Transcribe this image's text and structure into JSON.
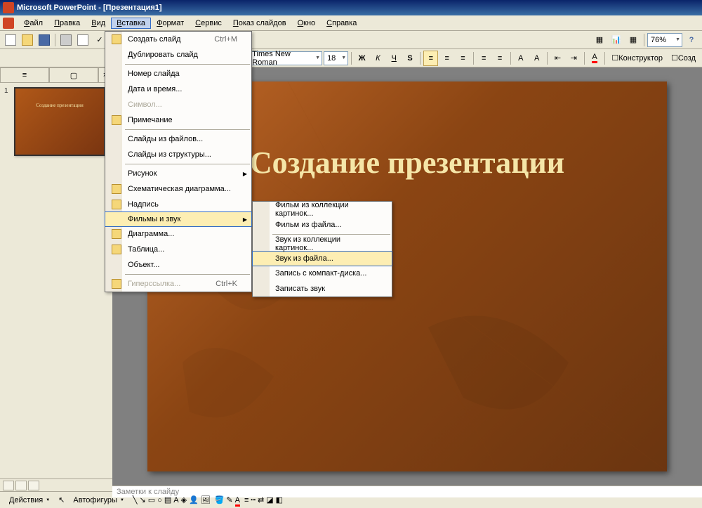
{
  "title": "Microsoft PowerPoint - [Презентация1]",
  "menubar": [
    "Файл",
    "Правка",
    "Вид",
    "Вставка",
    "Формат",
    "Сервис",
    "Показ слайдов",
    "Окно",
    "Справка"
  ],
  "active_menu_index": 3,
  "toolbar2": {
    "font": "Times New Roman",
    "size": "18",
    "zoom": "76%",
    "designer": "Конструктор",
    "create": "Созд"
  },
  "insert_menu": [
    {
      "label": "Создать слайд",
      "shortcut": "Ctrl+M",
      "icon": "new-slide"
    },
    {
      "label": "Дублировать слайд"
    },
    {
      "sep": true
    },
    {
      "label": "Номер слайда"
    },
    {
      "label": "Дата и время..."
    },
    {
      "label": "Символ...",
      "disabled": true
    },
    {
      "label": "Примечание",
      "icon": "note"
    },
    {
      "sep": true
    },
    {
      "label": "Слайды из файлов..."
    },
    {
      "label": "Слайды из структуры..."
    },
    {
      "sep": true
    },
    {
      "label": "Рисунок",
      "submenu": true
    },
    {
      "label": "Схематическая диаграмма...",
      "icon": "diagram"
    },
    {
      "label": "Надпись",
      "icon": "textbox"
    },
    {
      "label": "Фильмы и звук",
      "submenu": true,
      "highlighted": true
    },
    {
      "label": "Диаграмма...",
      "icon": "chart"
    },
    {
      "label": "Таблица...",
      "icon": "table"
    },
    {
      "label": "Объект..."
    },
    {
      "sep": true
    },
    {
      "label": "Гиперссылка...",
      "shortcut": "Ctrl+K",
      "disabled": true,
      "icon": "link"
    }
  ],
  "sound_submenu": [
    {
      "label": "Фильм из коллекции картинок..."
    },
    {
      "label": "Фильм из файла..."
    },
    {
      "sep": true
    },
    {
      "label": "Звук из коллекции картинок..."
    },
    {
      "label": "Звук из файла...",
      "highlighted": true
    },
    {
      "label": "Запись с компакт-диска..."
    },
    {
      "label": "Записать звук"
    }
  ],
  "slide": {
    "number": "1",
    "title": "Создание презентации",
    "thumb_title": "Создание презентации"
  },
  "notes_placeholder": "Заметки к слайду",
  "drawing_bar": {
    "actions": "Действия",
    "autoshapes": "Автофигуры"
  }
}
